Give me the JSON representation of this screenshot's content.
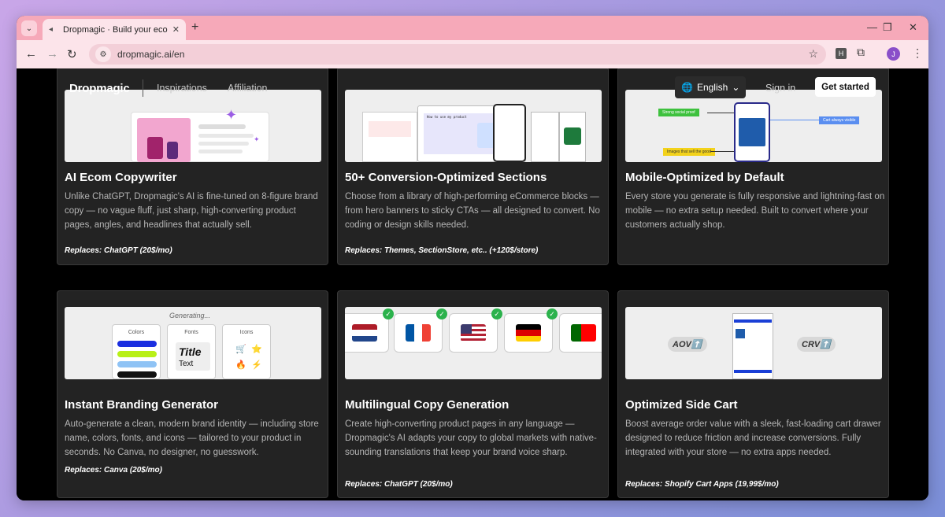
{
  "browser": {
    "tab_title": "Dropmagic · Build your ecommerce",
    "url": "dropmagic.ai/en",
    "profile_initial": "J",
    "extension_label": "H"
  },
  "site_header": {
    "logo": "Dropmagic",
    "nav": [
      "Inspirations",
      "Affiliation"
    ],
    "language": "English",
    "sign_in": "Sign in",
    "cta": "Get started"
  },
  "cards": [
    {
      "title": "AI Ecom Copywriter",
      "description": "Unlike ChatGPT, Dropmagic's AI is fine-tuned on 8-figure brand copy — no vague fluff, just sharp, high-converting product pages, angles, and headlines that actually sell.",
      "replaces": "Replaces: ChatGPT (20$/mo)"
    },
    {
      "title": "50+ Conversion-Optimized Sections",
      "description": "Choose from a library of high-performing eCommerce blocks — from hero banners to sticky CTAs — all designed to convert. No coding or design skills needed.",
      "replaces": "Replaces:  Themes, SectionStore, etc.. (+120$/store)"
    },
    {
      "title": "Mobile-Optimized by Default",
      "description": "Every store you generate is fully responsive and lightning-fast on mobile — no extra setup needed. Built to convert where your customers actually shop.",
      "replaces": ""
    },
    {
      "title": "Instant Branding Generator",
      "description": "Auto-generate a clean, modern brand identity — including store name, colors, fonts, and icons — tailored to your product in seconds. No Canva, no designer, no guesswork.",
      "replaces": "Replaces: Canva (20$/mo)"
    },
    {
      "title": "Multilingual Copy Generation",
      "description": "Create high-converting product pages in any language — Dropmagic's AI adapts your copy to global markets with native-sounding translations that keep your brand voice sharp.",
      "replaces": "Replaces: ChatGPT (20$/mo)"
    },
    {
      "title": "Optimized Side Cart",
      "description": "Boost average order value with a sleek, fast-loading cart drawer designed to reduce friction and increase conversions. Fully integrated with your store — no extra apps needed.",
      "replaces": "Replaces: Shopify Cart Apps (19,99$/mo)"
    }
  ],
  "illustrations": {
    "sections_heading": "How to use my product",
    "mobile_tag_green": "Strong social proof",
    "mobile_tag_blue": "Cart always visible",
    "mobile_tag_yellow": "Images that sell the good",
    "branding_generating": "Generating...",
    "branding_colors": "Colors",
    "branding_fonts": "Fonts",
    "branding_icons": "Icons",
    "branding_title_sample": "Title",
    "branding_text_sample": "Text",
    "cart_aov": "AOV⬆️",
    "cart_crv": "CRV⬆️",
    "palette": [
      "#1a2ee0",
      "#b8f017",
      "#8fc3f5",
      "#111111"
    ]
  }
}
